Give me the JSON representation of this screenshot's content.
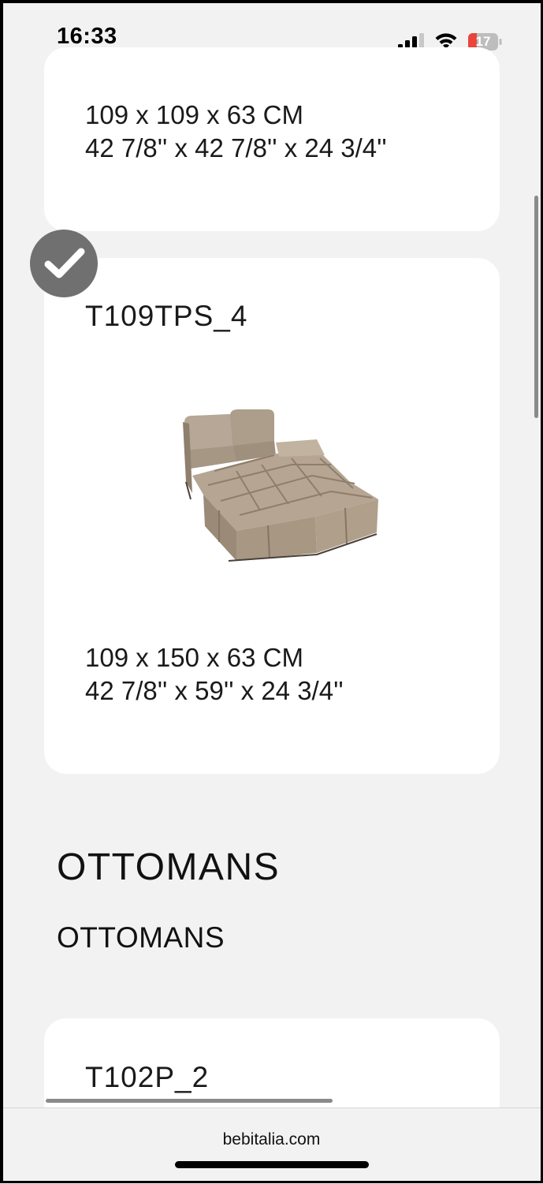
{
  "status_bar": {
    "time": "16:33",
    "battery_level": "17",
    "signal_icon": "cellular-signal-icon",
    "wifi_icon": "wifi-icon",
    "battery_icon": "battery-low-icon"
  },
  "cards": [
    {
      "dimensions_cm": "109 x 109 x 63 CM",
      "dimensions_in": "42 7/8'' x 42 7/8'' x 24 3/4''"
    },
    {
      "code": "T109TPS_4",
      "selected": true,
      "image": "modular-chaise-sofa-module",
      "dimensions_cm": "109 x 150 x 63 CM",
      "dimensions_in": "42 7/8'' x 59'' x 24 3/4''"
    },
    {
      "code": "T102P_2"
    }
  ],
  "section": {
    "title": "OTTOMANS",
    "subtitle": "OTTOMANS"
  },
  "browser": {
    "url": "bebitalia.com"
  },
  "colors": {
    "background": "#f2f2f2",
    "card": "#ffffff",
    "check_badge": "#707070",
    "battery_low": "#e8453c"
  }
}
